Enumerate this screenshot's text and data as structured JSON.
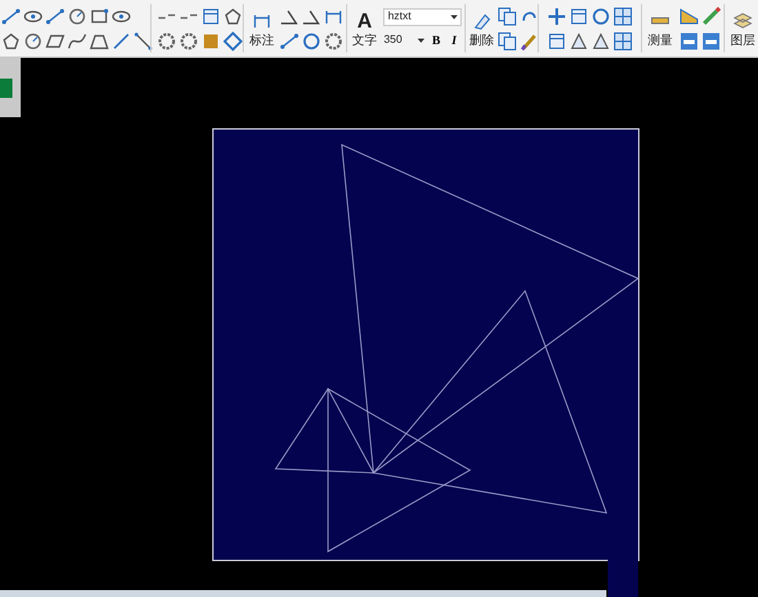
{
  "toolbar": {
    "dimension_label": "标注",
    "text_tool": "A",
    "text_label": "文字",
    "font_field": {
      "value": "hztxt"
    },
    "size_field": {
      "value": "350"
    },
    "bold_button": "B",
    "italic_button": "I",
    "delete_label": "删除",
    "measure_label": "测量",
    "layer_label": "图层"
  }
}
